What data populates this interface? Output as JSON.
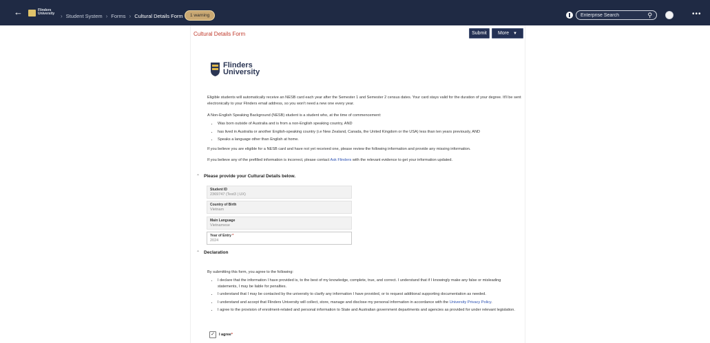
{
  "topbar": {
    "back_icon": "arrow-left-icon",
    "logo_text_line1": "Flinders",
    "logo_text_line2": "University",
    "breadcrumbs": [
      "Student System",
      "Forms",
      "Cultural Details Form"
    ],
    "separator": "›",
    "warning_badge": "1 warning",
    "search_placeholder": "Enterprise Search",
    "more_menu": "•••"
  },
  "form": {
    "title": "Cultural Details Form",
    "submit_label": "Submit",
    "more_label": "More",
    "university_name_line1": "Flinders",
    "university_name_line2": "University",
    "intro_paragraph": "Eligible students will automatically receive an NESB card each year after the Semester 1 and Semester 2 census dates. Your card stays valid for the duration of your degree. It'll be sent electronically to your Flinders email address, so you won't need a new one every year.",
    "nesb_definition": "A Non-English Speaking Background (NESB) student is a student who, at the time of commencement:",
    "nesb_criteria": [
      "Was born outside of Australia and is from a non-English speaking country, AND",
      "has lived in Australia or another English-speaking country (i.e New Zealand, Canada, the United Kingdom or the USA) less than ten years previously, AND",
      "Speaks a language other than English at home."
    ],
    "eligibility_note": "If you believe you are eligible for a NESB card and have not yet received one, please review the following information and provide any missing information.",
    "incorrect_note_prefix": "If you believe any of the prefilled information is incorrect, please contact ",
    "incorrect_note_link": "Ask Flinders",
    "incorrect_note_suffix": " with the relevant evidence to get your information updated.",
    "section_cultural": "Please provide your Cultural Details below.",
    "fields": [
      {
        "label": "Student ID",
        "value": "2369747 (Test3 | UX)"
      },
      {
        "label": "Country of Birth",
        "value": "Vietnam"
      },
      {
        "label": "Main Language",
        "value": "Vietnamese"
      },
      {
        "label": "Year of Entry",
        "value": "2024",
        "required": "*"
      }
    ],
    "section_declaration": "Declaration",
    "declaration_intro": "By submitting this form, you agree to the following:",
    "declarations": [
      "I declare that the information I have provided is, to the best of my knowledge, complete, true, and correct.  I understand that if I knowingly make any false or misleading statements, I may be liable for penalties.",
      "I understand that I may be contacted by the university to clarify any information I have provided, or to request additional supporting documentation as needed.",
      "I understand and accept that Flinders University will collect, store, manage and disclose my personal information in accordance with the ",
      "I agree to the provision of enrolment-related and personal information to State and Australian government departments and agencies as provided for under relevant legislation."
    ],
    "privacy_link": "University Privacy Policy",
    "privacy_suffix": ".",
    "agree_label": "I agree",
    "agree_required": "*",
    "agree_checked": "✓"
  }
}
